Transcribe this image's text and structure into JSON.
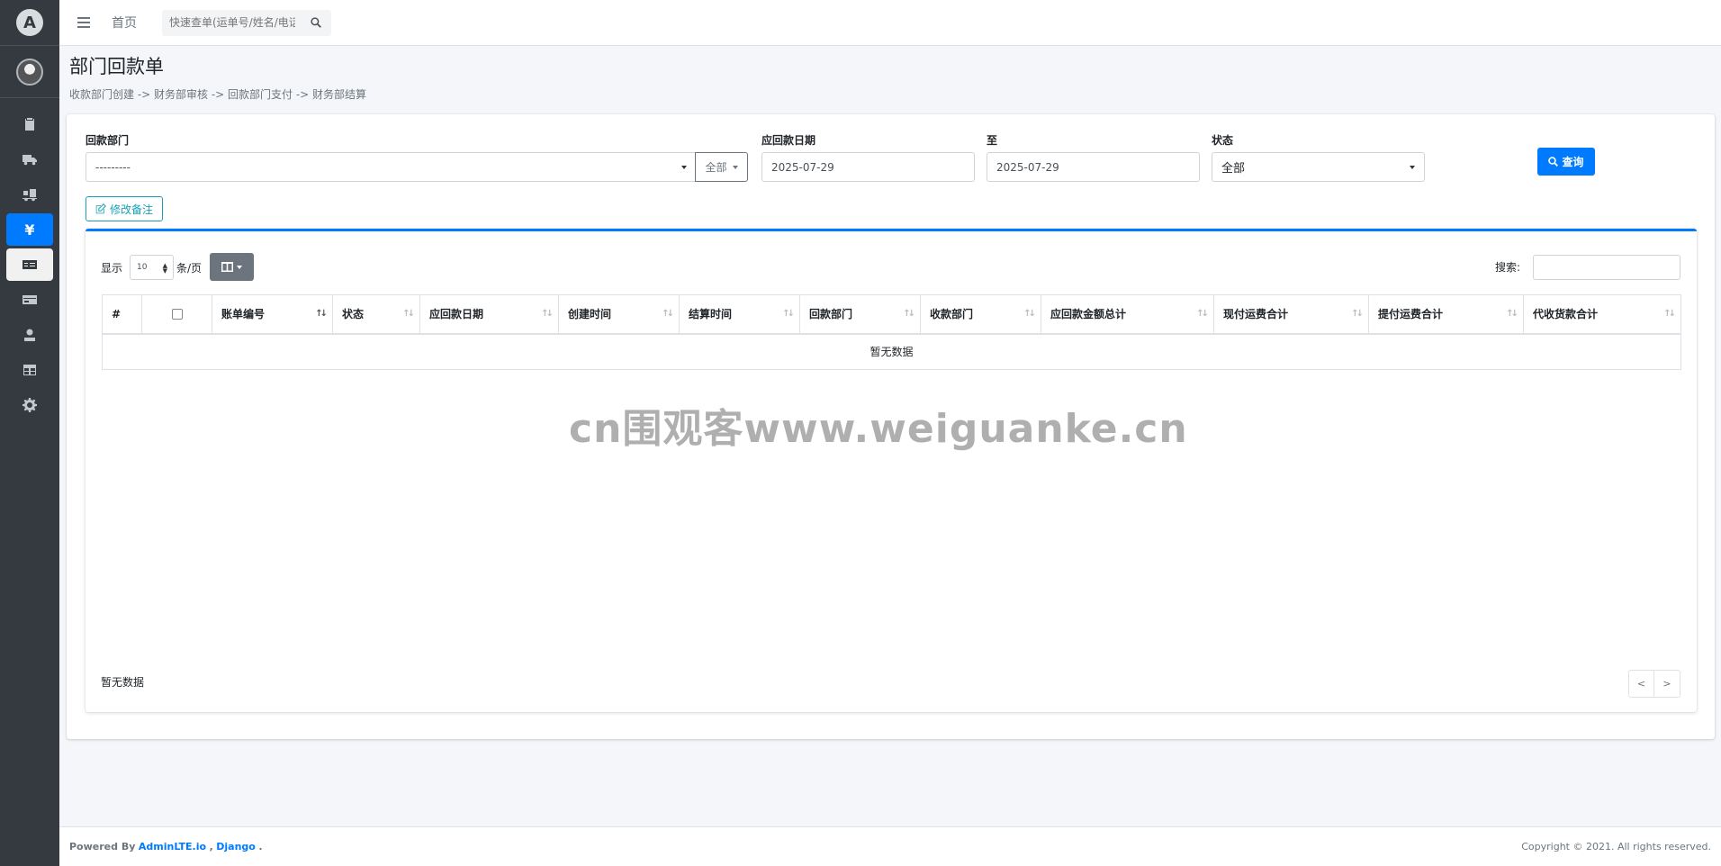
{
  "navbar": {
    "home_label": "首页",
    "search_placeholder": "快速查单(运单号/姓名/电话)"
  },
  "sidebar": {
    "items": [
      {
        "icon": "clipboard-icon"
      },
      {
        "icon": "truck-icon"
      },
      {
        "icon": "truck-loading-icon"
      },
      {
        "icon": "yen-icon"
      },
      {
        "icon": "money-check-icon"
      },
      {
        "icon": "credit-card-icon"
      },
      {
        "icon": "user-cash-icon"
      },
      {
        "icon": "table-icon"
      },
      {
        "icon": "gear-icon"
      }
    ],
    "brand_letter": "A"
  },
  "header": {
    "title": "部门回款单",
    "flow": "收款部门创建 -> 财务部审核 -> 回款部门支付 -> 财务部结算"
  },
  "filters": {
    "dept_label": "回款部门",
    "dept_value": "---------",
    "dept_all_label": "全部",
    "date_label": "应回款日期",
    "date_from": "2025-07-29",
    "to_label": "至",
    "date_to": "2025-07-29",
    "status_label": "状态",
    "status_value": "全部",
    "query_label": "查询",
    "remark_label": "修改备注"
  },
  "table_controls": {
    "show_label": "显示",
    "page_size": "10",
    "per_page_label": "条/页",
    "search_label": "搜索:"
  },
  "table": {
    "columns": [
      "#",
      "",
      "账单编号",
      "状态",
      "应回款日期",
      "创建时间",
      "结算时间",
      "回款部门",
      "收款部门",
      "应回款金额总计",
      "现付运费合计",
      "提付运费合计",
      "代收货款合计"
    ],
    "empty_text": "暂无数据"
  },
  "pagination": {
    "info": "暂无数据",
    "prev": "<",
    "next": ">"
  },
  "watermark": "cn围观客www.weiguanke.cn",
  "footer": {
    "powered_prefix": "Powered By",
    "link1": "AdminLTE.io",
    "sep": ",",
    "link2": "Django",
    "dot": ".",
    "copyright": "Copyright © 2021. All rights reserved."
  },
  "colors": {
    "primary": "#007bff",
    "sidebar": "#343a40",
    "info": "#17a2b8"
  }
}
